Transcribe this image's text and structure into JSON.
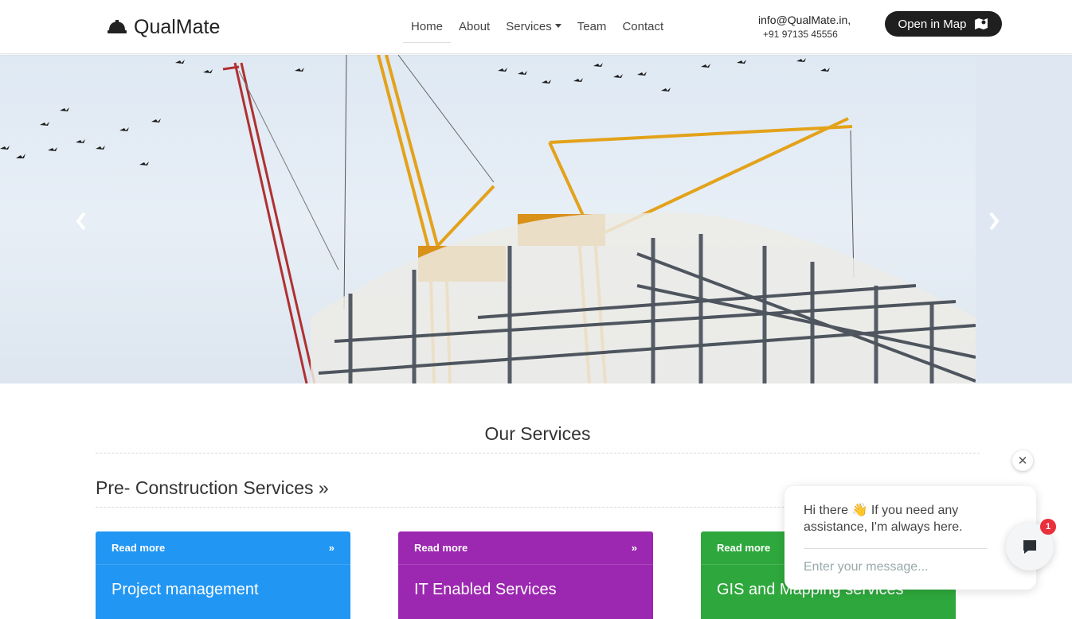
{
  "brand": {
    "name": "QualMate",
    "icon": "hard-hat-icon"
  },
  "nav": {
    "items": [
      {
        "label": "Home",
        "active": true
      },
      {
        "label": "About"
      },
      {
        "label": "Services",
        "dropdown": true
      },
      {
        "label": "Team"
      },
      {
        "label": "Contact"
      }
    ]
  },
  "contact": {
    "email": "info@QualMate.in,",
    "phone": "+91 97135 45556"
  },
  "map_button": {
    "label": "Open in Map",
    "icon": "map-icon"
  },
  "hero": {
    "image": "construction-cranes",
    "prev_icon": "chevron-left-icon",
    "next_icon": "chevron-right-icon"
  },
  "services": {
    "title": "Our Services",
    "subtitle": "Pre- Construction Services »",
    "cards": [
      {
        "read_more": "Read more",
        "title": "Project management",
        "color": "#2196f3"
      },
      {
        "read_more": "Read more",
        "title": "IT Enabled Services",
        "color": "#9c27b0"
      },
      {
        "read_more": "Read more",
        "title": "GIS and Mapping services",
        "color": "#2ea83c"
      }
    ]
  },
  "chat": {
    "message": "Hi there 👋 If you need any assistance, I'm always here.",
    "placeholder": "Enter your message...",
    "badge": "1",
    "close_icon": "close-icon",
    "launcher_icon": "chat-bubble-icon"
  }
}
